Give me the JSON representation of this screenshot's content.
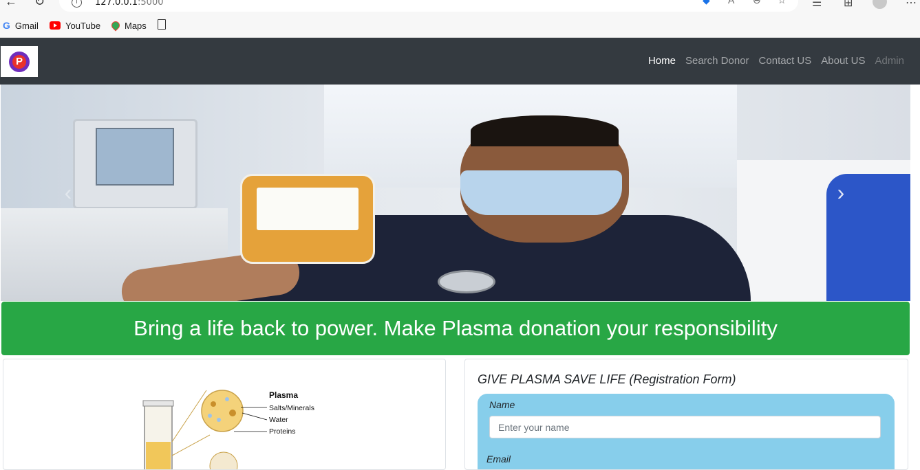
{
  "browser": {
    "url_host": "127.0.0.1",
    "url_port": ":5000",
    "bookmarks": [
      {
        "label": "Gmail",
        "icon": "google-icon"
      },
      {
        "label": "YouTube",
        "icon": "youtube-icon"
      },
      {
        "label": "Maps",
        "icon": "maps-icon"
      }
    ]
  },
  "navbar": {
    "logo_letter": "P",
    "links": [
      {
        "label": "Home",
        "state": "active"
      },
      {
        "label": "Search Donor",
        "state": "normal"
      },
      {
        "label": "Contact US",
        "state": "normal"
      },
      {
        "label": "About US",
        "state": "normal"
      },
      {
        "label": "Admin",
        "state": "disabled"
      }
    ],
    "background": "#343a40"
  },
  "carousel": {
    "prev_icon": "chevron-left-icon",
    "next_icon": "chevron-right-icon"
  },
  "banner": {
    "text": "Bring a life back to power. Make Plasma donation your responsibility",
    "color": "#28a745"
  },
  "diagram": {
    "title": "Plasma",
    "labels": [
      "Salts/Minerals",
      "Water",
      "Proteins"
    ]
  },
  "form": {
    "title": "GIVE PLASMA SAVE LIFE (Registration Form)",
    "panel_color": "#87ceeb",
    "name_label": "Name",
    "name_placeholder": "Enter your name",
    "email_label": "Email"
  }
}
